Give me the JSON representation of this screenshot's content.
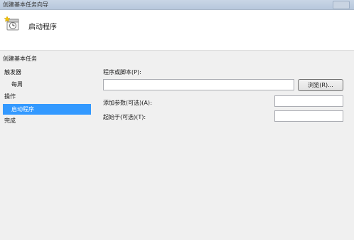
{
  "window": {
    "title": "创建基本任务向导"
  },
  "header": {
    "heading": "启动程序",
    "icon": "task-clock-icon"
  },
  "sidebar": {
    "items": [
      {
        "label": "创建基本任务"
      },
      {
        "label": "触发器"
      },
      {
        "label": "每周"
      },
      {
        "label": "操作"
      },
      {
        "label": "启动程序",
        "selected": true
      },
      {
        "label": "完成"
      }
    ],
    "selected_color": "#3399ff"
  },
  "form": {
    "program_label": "程序或脚本(P):",
    "program_value": "",
    "browse_label": "浏览(R)...",
    "args_label": "添加参数(可选)(A):",
    "args_value": "",
    "start_in_label": "起始于(可选)(T):",
    "start_in_value": ""
  }
}
